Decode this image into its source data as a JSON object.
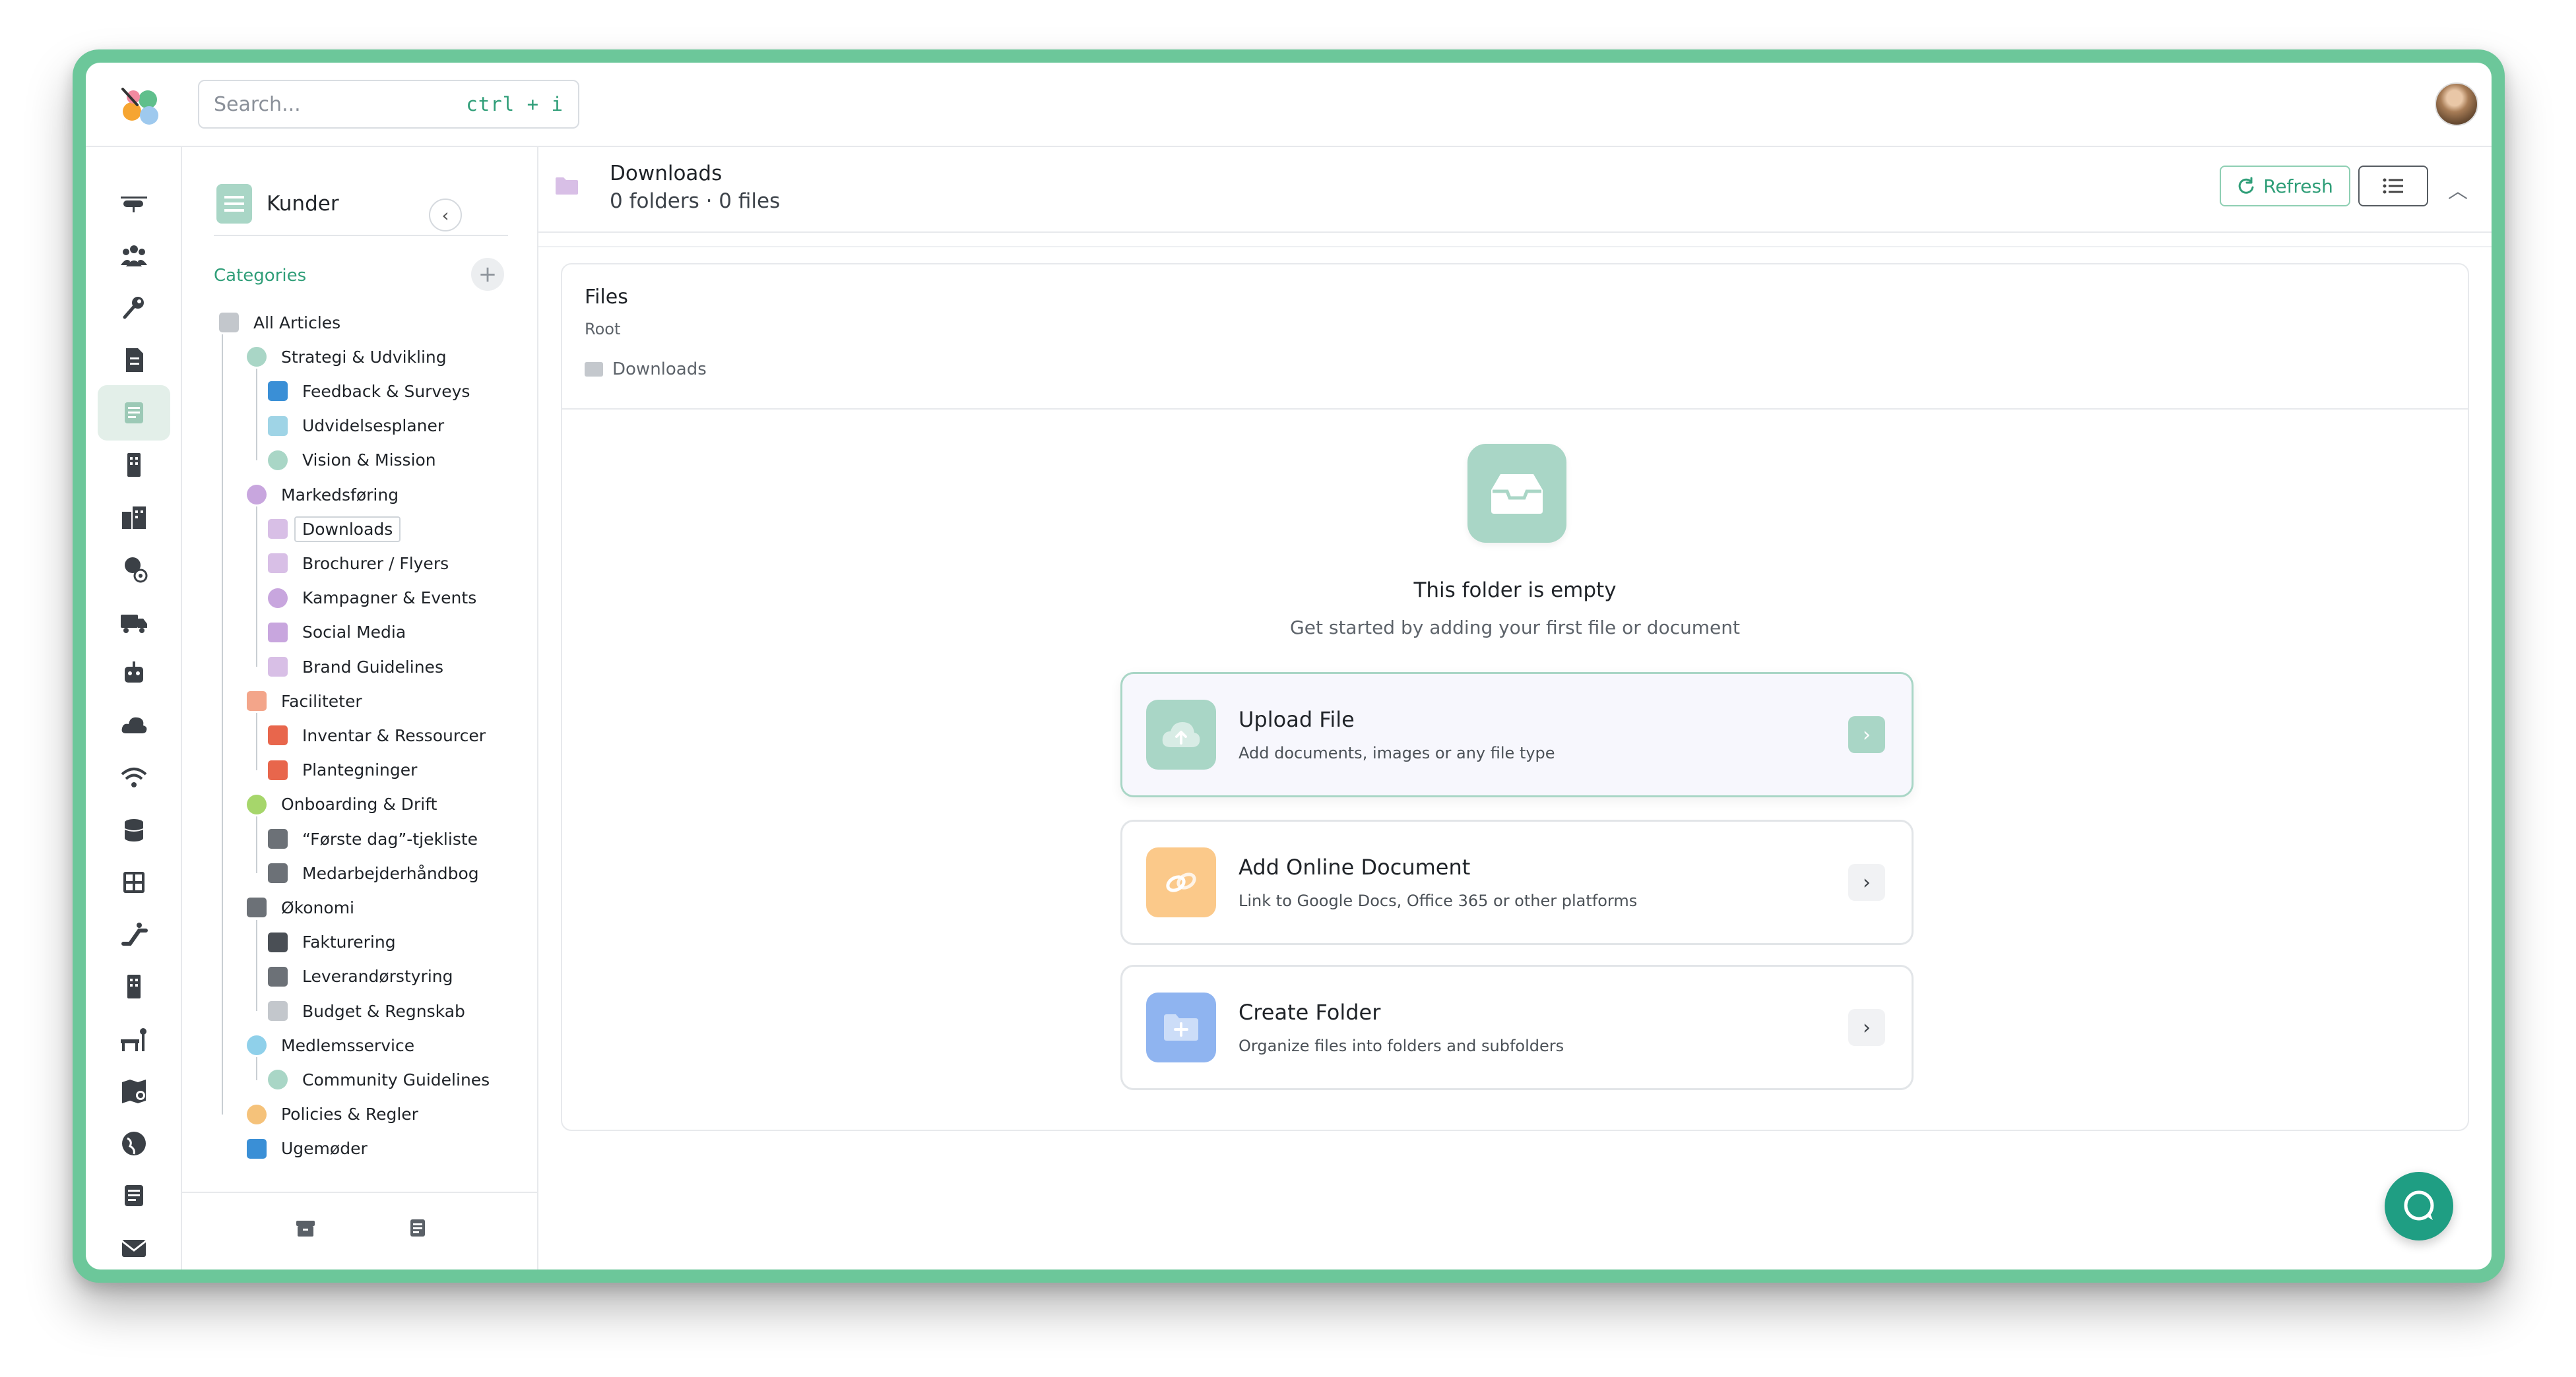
{
  "search": {
    "placeholder": "Search...",
    "shortcut": "ctrl + i"
  },
  "rail": {
    "items": [
      "helicopter-icon",
      "users-icon",
      "key-icon",
      "document-icon",
      "article-icon",
      "building-icon",
      "city-icon",
      "user-settings-icon",
      "truck-icon",
      "robot-icon",
      "cloud-icon",
      "wifi-icon",
      "database-icon",
      "grid-icon",
      "escalator-icon",
      "office-icon",
      "workspace-icon",
      "map-pin-icon",
      "globe-icon",
      "notes-icon",
      "mail-icon"
    ],
    "active_index": 4
  },
  "panel": {
    "title": "Kunder",
    "categories_label": "Categories",
    "add_label": "+",
    "tree": [
      {
        "label": "All Articles",
        "level": 0,
        "icon": "inbox-icon",
        "color": "#c3c7cc"
      },
      {
        "label": "Strategi & Udvikling",
        "level": 1,
        "icon": "pie-chart-icon",
        "color": "#a9d6c6",
        "caret": true
      },
      {
        "label": "Feedback & Surveys",
        "level": 2,
        "icon": "graduation-cap-icon",
        "color": "#3a8fd6"
      },
      {
        "label": "Udvidelsesplaner",
        "level": 2,
        "icon": "puzzle-icon",
        "color": "#9fd4e6"
      },
      {
        "label": "Vision & Mission",
        "level": 2,
        "icon": "compass-icon",
        "color": "#a9d6c6"
      },
      {
        "label": "Markedsføring",
        "level": 1,
        "icon": "fire-icon",
        "color": "#c8a6de",
        "caret": true
      },
      {
        "label": "Downloads",
        "level": 2,
        "icon": "folder-icon",
        "color": "#d8bfe6",
        "selected": true
      },
      {
        "label": "Brochurer / Flyers",
        "level": 2,
        "icon": "brochure-icon",
        "color": "#d8bfe6"
      },
      {
        "label": "Kampagner & Events",
        "level": 2,
        "icon": "globe-icon",
        "color": "#c8a6de"
      },
      {
        "label": "Social Media",
        "level": 2,
        "icon": "megaphone-icon",
        "color": "#c8a6de"
      },
      {
        "label": "Brand Guidelines",
        "level": 2,
        "icon": "bolt-icon",
        "color": "#d8bfe6"
      },
      {
        "label": "Faciliteter",
        "level": 1,
        "icon": "grid-icon",
        "color": "#f3a58a",
        "caret": true
      },
      {
        "label": "Inventar & Ressourcer",
        "level": 2,
        "icon": "wrench-icon",
        "color": "#e8664c"
      },
      {
        "label": "Plantegninger",
        "level": 2,
        "icon": "dots-grid-icon",
        "color": "#e8664c"
      },
      {
        "label": "Onboarding & Drift",
        "level": 1,
        "icon": "leaf-icon",
        "color": "#a6d66b",
        "caret": true
      },
      {
        "label": "“Første dag”-tjekliste",
        "level": 2,
        "icon": "calculator-icon",
        "color": "#6c7177"
      },
      {
        "label": "Medarbejderhåndbog",
        "level": 2,
        "icon": "book-icon",
        "color": "#6c7177"
      },
      {
        "label": "Økonomi",
        "level": 1,
        "icon": "line-chart-icon",
        "color": "#6c7177",
        "caret": true
      },
      {
        "label": "Fakturering",
        "level": 2,
        "icon": "list-icon",
        "color": "#4a4f55"
      },
      {
        "label": "Leverandørstyring",
        "level": 2,
        "icon": "building-icon",
        "color": "#6c7177"
      },
      {
        "label": "Budget & Regnskab",
        "level": 2,
        "icon": "folder-icon",
        "color": "#c3c7cc"
      },
      {
        "label": "Medlemsservice",
        "level": 1,
        "icon": "lightbulb-icon",
        "color": "#8fd0ea",
        "caret": true
      },
      {
        "label": "Community Guidelines",
        "level": 2,
        "icon": "heart-icon",
        "color": "#a9d6c6"
      },
      {
        "label": "Policies & Regler",
        "level": 1,
        "icon": "warning-icon",
        "color": "#f5c27a"
      },
      {
        "label": "Ugemøder",
        "level": 1,
        "icon": "rocket-icon",
        "color": "#3a8fd6"
      }
    ]
  },
  "header": {
    "title": "Downloads",
    "subtitle": "0 folders · 0 files",
    "refresh_label": "Refresh"
  },
  "files": {
    "title": "Files",
    "root_label": "Root",
    "breadcrumb": "Downloads",
    "empty_title": "This folder is empty",
    "empty_subtitle": "Get started by adding your first file or document",
    "actions": [
      {
        "title": "Upload File",
        "subtitle": "Add documents, images or any file type",
        "icon": "cloud-upload-icon",
        "color": "#a9d6c6"
      },
      {
        "title": "Add Online Document",
        "subtitle": "Link to Google Docs, Office 365 or other platforms",
        "icon": "link-icon",
        "color": "#fbc98a"
      },
      {
        "title": "Create Folder",
        "subtitle": "Organize files into folders and subfolders",
        "icon": "folder-plus-icon",
        "color": "#8fb4f0"
      }
    ]
  },
  "colors": {
    "accent": "#2f9e78",
    "frame": "#6cc79a",
    "mint": "#a9d6c6"
  }
}
